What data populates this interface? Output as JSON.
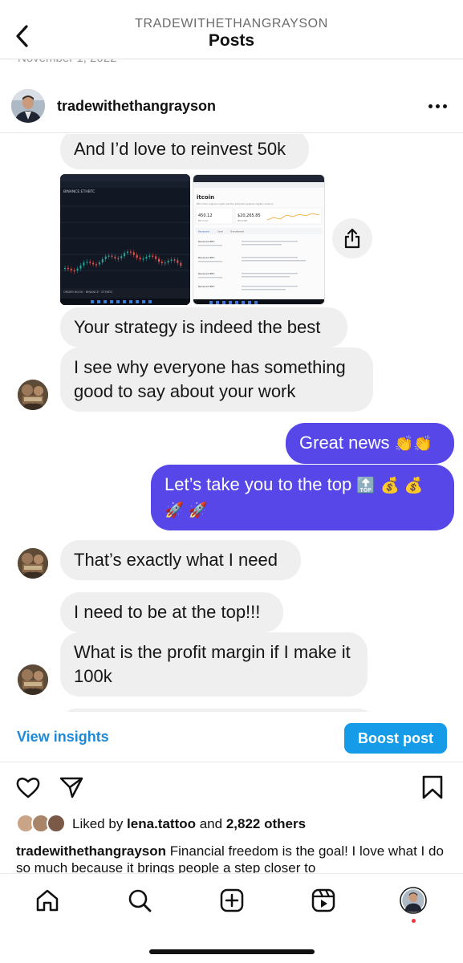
{
  "header": {
    "account": "TRADEWITHETHANGRAYSON",
    "title": "Posts",
    "peek_date": "November 1, 2022"
  },
  "post": {
    "username": "tradewithethangrayson"
  },
  "chat": {
    "messages": [
      {
        "side": "in",
        "text": "And I’d love to reinvest 50k"
      },
      {
        "side": "in",
        "text": "Your strategy is indeed the best"
      },
      {
        "side": "in",
        "text": "I see why everyone has something good to say about your work"
      },
      {
        "side": "out",
        "text": "Great news",
        "emoji": "👏👏"
      },
      {
        "side": "out",
        "text": "Let’s take you to the top",
        "emoji": "🔝 💰 💰 🚀 🚀"
      },
      {
        "side": "in",
        "text": "That’s exactly what I need"
      },
      {
        "side": "in",
        "text": "I need to be at the top!!!"
      },
      {
        "side": "in",
        "text": "What is the profit margin if I make it 100k"
      }
    ],
    "screenshot_left": {
      "pair": "BINANCE:ETHBTC",
      "bottom": "ORDER BOOK · BINANCE · ETHBTC"
    },
    "screenshot_right": {
      "title": "itcoin",
      "subtitle": "BTC is the original crypto and the internet's premier digital currency.",
      "balance": "450.12",
      "balance_sub": "BTC held",
      "price": "$20,265.85",
      "price_sub": "BTC/USD",
      "tabs": [
        "Received",
        "Sent",
        "Transferred"
      ],
      "rows": [
        "Received BTC",
        "Received BTC",
        "Received BTC",
        "Received BTC"
      ]
    }
  },
  "insights": {
    "view": "View insights",
    "boost": "Boost post"
  },
  "likes": {
    "prefix": "Liked by ",
    "user": "lena.tattoo",
    "middle": " and ",
    "others": "2,822 others"
  },
  "caption": {
    "username": "tradewithethangrayson",
    "text": " Financial freedom is the goal! I love what I do so much because it brings people a step closer to"
  },
  "colors": {
    "outgoing_bubble": "#5747e8",
    "incoming_bubble": "#efefef",
    "link_blue": "#1d8ad9",
    "boost_blue": "#169be8",
    "notification_red": "#ff3040"
  },
  "icons": {
    "back": "chevron-left-icon",
    "more": "more-horizontal-icon",
    "share": "share-icon",
    "like": "heart-icon",
    "send": "send-icon",
    "save": "bookmark-icon",
    "nav": [
      "home-icon",
      "search-icon",
      "create-icon",
      "reels-icon",
      "profile-avatar"
    ]
  }
}
